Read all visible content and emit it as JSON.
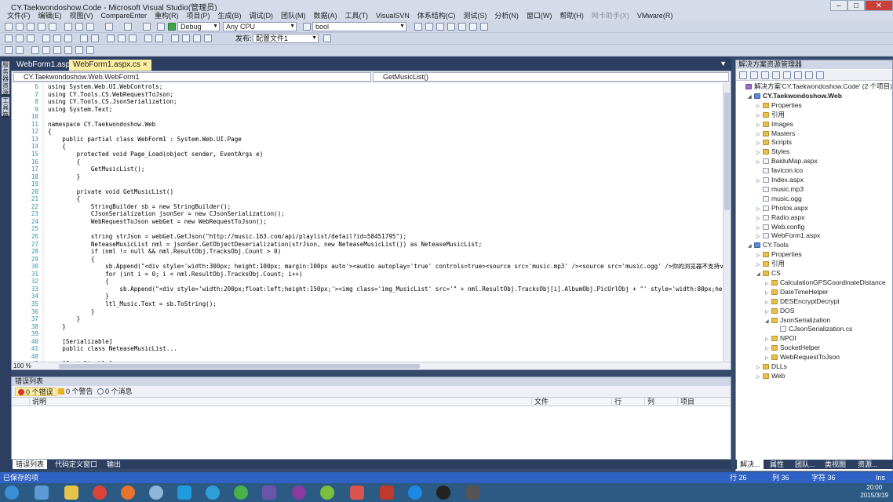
{
  "window": {
    "title": "CY.Taekwondoshow.Code - Microsoft Visual Studio(管理员)"
  },
  "menu": [
    "文件(F)",
    "编辑(E)",
    "视图(V)",
    "CompareEnter",
    "重构(R)",
    "项目(P)",
    "生成(B)",
    "调试(D)",
    "团队(M)",
    "数据(A)",
    "工具(T)",
    "VisualSVN",
    "体系结构(C)",
    "测试(S)",
    "分析(N)",
    "窗口(W)",
    "帮助(H)",
    "网卡助手(X)",
    "VMware(R)"
  ],
  "toolbar": {
    "config": "Debug",
    "platform": "Any CPU",
    "find": "bool",
    "publish_label": "发布:",
    "publish_profile": "配置文件1"
  },
  "tabs": [
    {
      "label": "WebForm1.aspx"
    },
    {
      "label": "WebForm1.aspx.cs ×"
    }
  ],
  "editor": {
    "nav_left": "CY.Taekwondoshow.Web.WebForm1",
    "nav_right": "GetMusicList()",
    "zoom": "100 %",
    "lines": [
      {
        "n": "6",
        "t": "using System.Web.UI.WebControls;"
      },
      {
        "n": "7",
        "t": "using CY.Tools.CS.WebRequestToJson;"
      },
      {
        "n": "8",
        "t": "using CY.Tools.CS.JsonSerialization;"
      },
      {
        "n": "9",
        "t": "using System.Text;"
      },
      {
        "n": "10",
        "t": ""
      },
      {
        "n": "11",
        "t": "namespace CY.Taekwondoshow.Web"
      },
      {
        "n": "12",
        "t": "{"
      },
      {
        "n": "13",
        "t": "    public partial class WebForm1 : System.Web.UI.Page"
      },
      {
        "n": "14",
        "t": "    {"
      },
      {
        "n": "15",
        "t": "        protected void Page_Load(object sender, EventArgs e)"
      },
      {
        "n": "16",
        "t": "        {"
      },
      {
        "n": "17",
        "t": "            GetMusicList();"
      },
      {
        "n": "18",
        "t": "        }"
      },
      {
        "n": "19",
        "t": ""
      },
      {
        "n": "20",
        "t": "        private void GetMusicList()"
      },
      {
        "n": "21",
        "t": "        {"
      },
      {
        "n": "22",
        "t": "            StringBuilder sb = new StringBuilder();"
      },
      {
        "n": "23",
        "t": "            CJsonSerialization jsonSer = new CJsonSerialization();"
      },
      {
        "n": "24",
        "t": "            WebRequestToJson webGet = new WebRequestToJson();"
      },
      {
        "n": "25",
        "t": ""
      },
      {
        "n": "26",
        "t": "            string strJson = webGet.GetJson(\"http://music.163.com/api/playlist/detail?id=58451795\");"
      },
      {
        "n": "27",
        "t": "            NeteaseMusicList nml = jsonSer.GetObjectDeserialization(strJson, new NeteaseMusicList()) as NeteaseMusicList;"
      },
      {
        "n": "28",
        "t": "            if (nml != null && nml.ResultObj.TracksObj.Count > 0)"
      },
      {
        "n": "29",
        "t": "            {"
      },
      {
        "n": "30",
        "t": "                sb.Append(\"<div style='width:300px; height:100px; margin:100px auto'><audio autoplay='true' controls=true><source src='music.mp3' /><source src='music.ogg' />你的浏览器不支持video标签。</audio"
      },
      {
        "n": "31",
        "t": "                for (int i = 0; i < nml.ResultObj.TracksObj.Count; i++)"
      },
      {
        "n": "32",
        "t": "                {"
      },
      {
        "n": "33",
        "t": "                    sb.Append(\"<div style='width:200px;float:left;height:150px;'><img class='img_MusicList' src='\" + nml.ResultObj.TracksObj[i].AlbumObj.PicUrlObj + \"' style='width:80px;height:80px;' title='\""
      },
      {
        "n": "34",
        "t": "                }"
      },
      {
        "n": "35",
        "t": "                ltl_Music.Text = sb.ToString();"
      },
      {
        "n": "36",
        "t": "            }"
      },
      {
        "n": "37",
        "t": "        }"
      },
      {
        "n": "38",
        "t": "    }"
      },
      {
        "n": "39",
        "t": ""
      },
      {
        "n": "40",
        "t": "    [Serializable]"
      },
      {
        "n": "41",
        "t": "    public class NeteaseMusicList..."
      },
      {
        "n": "48",
        "t": ""
      },
      {
        "n": "49",
        "t": "    [Serializable]"
      }
    ]
  },
  "error_list": {
    "title": "错误列表",
    "errors": "0 个错误",
    "warnings": "0 个警告",
    "messages": "0 个消息",
    "columns": [
      "说明",
      "文件",
      "行",
      "列",
      "项目"
    ]
  },
  "bottom_tabs": [
    "错误列表",
    "代码定义窗口",
    "输出"
  ],
  "solution_explorer": {
    "title": "解决方案资源管理器",
    "nodes": [
      {
        "label": "解决方案'CY.Taekwondoshow.Code' (2 个项目)",
        "type": "sol",
        "level": 0,
        "bold": false,
        "tw": ""
      },
      {
        "label": "CY.Taekwondoshow.Web",
        "type": "proj",
        "level": 1,
        "bold": true,
        "tw": "◢"
      },
      {
        "label": "Properties",
        "type": "folder",
        "level": 2,
        "bold": false,
        "tw": "▷"
      },
      {
        "label": "引用",
        "type": "folder",
        "level": 2,
        "bold": false,
        "tw": "▷"
      },
      {
        "label": "Images",
        "type": "folder",
        "level": 2,
        "bold": false,
        "tw": "▷"
      },
      {
        "label": "Masters",
        "type": "folder",
        "level": 2,
        "bold": false,
        "tw": "▷"
      },
      {
        "label": "Scripts",
        "type": "folder",
        "level": 2,
        "bold": false,
        "tw": "▷"
      },
      {
        "label": "Styles",
        "type": "folder",
        "level": 2,
        "bold": false,
        "tw": "▷"
      },
      {
        "label": "BaiduMap.aspx",
        "type": "file",
        "level": 2,
        "bold": false,
        "tw": "▷"
      },
      {
        "label": "favicon.ico",
        "type": "file",
        "level": 2,
        "bold": false,
        "tw": ""
      },
      {
        "label": "Index.aspx",
        "type": "file",
        "level": 2,
        "bold": false,
        "tw": "▷"
      },
      {
        "label": "music.mp3",
        "type": "file",
        "level": 2,
        "bold": false,
        "tw": ""
      },
      {
        "label": "music.ogg",
        "type": "file",
        "level": 2,
        "bold": false,
        "tw": ""
      },
      {
        "label": "Photos.aspx",
        "type": "file",
        "level": 2,
        "bold": false,
        "tw": "▷"
      },
      {
        "label": "Radio.aspx",
        "type": "file",
        "level": 2,
        "bold": false,
        "tw": "▷"
      },
      {
        "label": "Web.config",
        "type": "file",
        "level": 2,
        "bold": false,
        "tw": "▷"
      },
      {
        "label": "WebForm1.aspx",
        "type": "file",
        "level": 2,
        "bold": false,
        "tw": "▷"
      },
      {
        "label": "CY.Tools",
        "type": "proj",
        "level": 1,
        "bold": false,
        "tw": "◢"
      },
      {
        "label": "Properties",
        "type": "folder",
        "level": 2,
        "bold": false,
        "tw": "▷"
      },
      {
        "label": "引用",
        "type": "folder",
        "level": 2,
        "bold": false,
        "tw": "▷"
      },
      {
        "label": "CS",
        "type": "folder",
        "level": 2,
        "bold": false,
        "tw": "◢"
      },
      {
        "label": "CalculationGPSCoordinateDistance",
        "type": "folder",
        "level": 3,
        "bold": false,
        "tw": "▷"
      },
      {
        "label": "DateTimeHelper",
        "type": "folder",
        "level": 3,
        "bold": false,
        "tw": "▷"
      },
      {
        "label": "DESEncryptDecrypt",
        "type": "folder",
        "level": 3,
        "bold": false,
        "tw": "▷"
      },
      {
        "label": "DOS",
        "type": "folder",
        "level": 3,
        "bold": false,
        "tw": "▷"
      },
      {
        "label": "JsonSerialization",
        "type": "folder",
        "level": 3,
        "bold": false,
        "tw": "◢"
      },
      {
        "label": "CJsonSerialization.cs",
        "type": "file",
        "level": 4,
        "bold": false,
        "tw": ""
      },
      {
        "label": "NPOI",
        "type": "folder",
        "level": 3,
        "bold": false,
        "tw": "▷"
      },
      {
        "label": "SocketHelper",
        "type": "folder",
        "level": 3,
        "bold": false,
        "tw": "▷"
      },
      {
        "label": "WebRequestToJson",
        "type": "folder",
        "level": 3,
        "bold": false,
        "tw": "▷"
      },
      {
        "label": "DLLs",
        "type": "folder",
        "level": 2,
        "bold": false,
        "tw": "▷"
      },
      {
        "label": "Web",
        "type": "folder",
        "level": 2,
        "bold": false,
        "tw": "▷"
      }
    ],
    "tabs": [
      "解决...",
      "属性",
      "团队...",
      "类视图",
      "资源..."
    ]
  },
  "status": {
    "left": "已保存的项",
    "row": "行 26",
    "col": "列 36",
    "ch": "字符 36",
    "mode": "Ins"
  },
  "clock": {
    "time": "20:00",
    "date": "2015/3/19"
  }
}
